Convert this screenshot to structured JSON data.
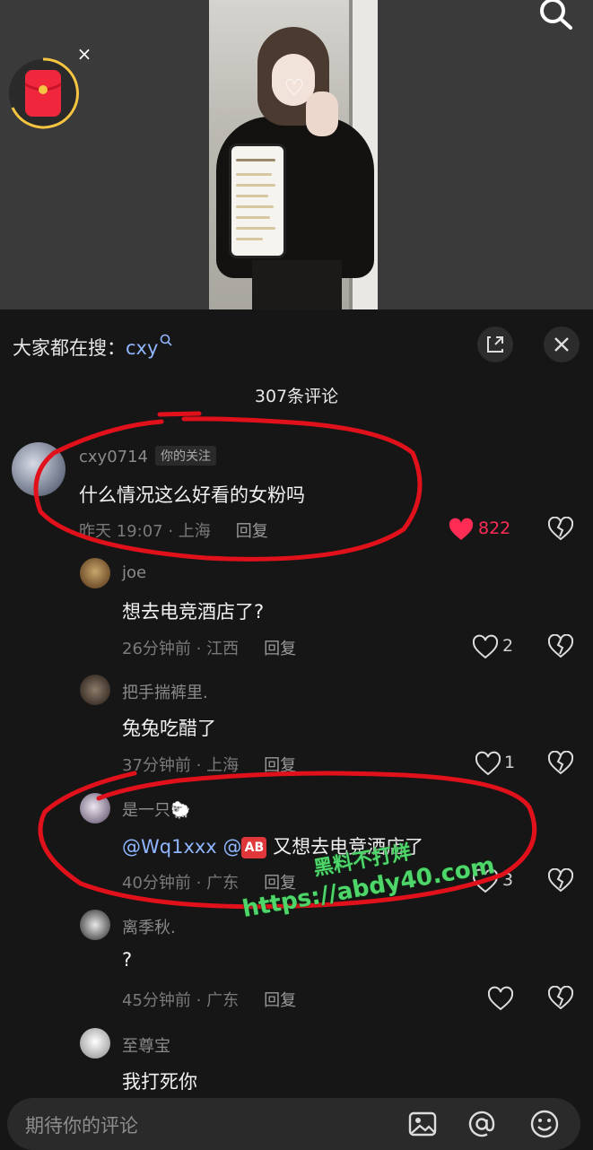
{
  "hot_search": {
    "prefix": "大家都在搜：",
    "keyword": "cxy"
  },
  "comment_count": "307条评论",
  "comments": [
    {
      "username": "cxy0714",
      "tag": "你的关注",
      "text": "什么情况这么好看的女粉吗",
      "meta": "昨天 19:07 · 上海",
      "reply": "回复",
      "likes": "822",
      "liked": true
    },
    {
      "username": "joe",
      "text": "想去电竞酒店了?",
      "meta": "26分钟前 · 江西",
      "reply": "回复",
      "likes": "2"
    },
    {
      "username": "把手揣裤里.",
      "text": "兔兔吃醋了",
      "meta": "37分钟前 · 上海",
      "reply": "回复",
      "likes": "1"
    },
    {
      "username": "是一只🐑",
      "mention1": "@Wq1xxx",
      "mention2": "@",
      "emoji": "AB",
      "text_rest": " 又想去电竞酒店了",
      "meta": "40分钟前 · 广东",
      "reply": "回复",
      "likes": "3"
    },
    {
      "username": "离季秋.",
      "text": "?",
      "meta": "45分钟前 · 广东",
      "reply": "回复",
      "likes": ""
    },
    {
      "username": "至尊宝",
      "text": "我打死你"
    }
  ],
  "input": {
    "placeholder": "期待你的评论"
  },
  "watermark": {
    "line1": "黑料不打烊",
    "line2": "https://abdy40.com"
  },
  "colors": {
    "accent_like": "#ff2d55",
    "mention": "#8fb6ff",
    "annotation": "#e1111b",
    "watermark": "#4fd66a"
  },
  "icons": [
    "search-icon",
    "red-packet-icon",
    "close-icon",
    "expand-icon",
    "heart-icon",
    "dislike-icon",
    "image-icon",
    "at-icon",
    "emoji-icon"
  ]
}
